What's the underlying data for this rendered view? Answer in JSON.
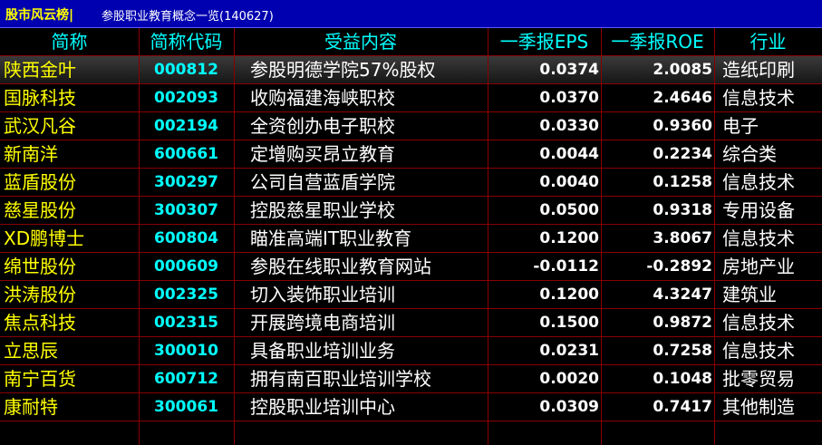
{
  "title": {
    "brand": "股市风云榜|",
    "text": "参股职业教育概念一览(140627)"
  },
  "columns": [
    "简称",
    "简称代码",
    "受益内容",
    "一季报EPS",
    "一季报ROE",
    "行业"
  ],
  "rows": [
    {
      "name": "陕西金叶",
      "code": "000812",
      "desc": "参股明德学院57%股权",
      "eps": "0.0374",
      "roe": "2.0085",
      "industry": "造纸印刷",
      "selected": true
    },
    {
      "name": "国脉科技",
      "code": "002093",
      "desc": "收购福建海峡职校",
      "eps": "0.0370",
      "roe": "2.4646",
      "industry": "信息技术"
    },
    {
      "name": "武汉凡谷",
      "code": "002194",
      "desc": "全资创办电子职校",
      "eps": "0.0330",
      "roe": "0.9360",
      "industry": "电子"
    },
    {
      "name": "新南洋",
      "code": "600661",
      "desc": "定增购买昂立教育",
      "eps": "0.0044",
      "roe": "0.2234",
      "industry": "综合类"
    },
    {
      "name": "蓝盾股份",
      "code": "300297",
      "desc": "公司自营蓝盾学院",
      "eps": "0.0040",
      "roe": "0.1258",
      "industry": "信息技术"
    },
    {
      "name": "慈星股份",
      "code": "300307",
      "desc": "控股慈星职业学校",
      "eps": "0.0500",
      "roe": "0.9318",
      "industry": "专用设备"
    },
    {
      "name": "XD鹏博士",
      "code": "600804",
      "desc": "瞄准高端IT职业教育",
      "eps": "0.1200",
      "roe": "3.8067",
      "industry": "信息技术"
    },
    {
      "name": "绵世股份",
      "code": "000609",
      "desc": "参股在线职业教育网站",
      "eps": "-0.0112",
      "roe": "-0.2892",
      "industry": "房地产业"
    },
    {
      "name": "洪涛股份",
      "code": "002325",
      "desc": "切入装饰职业培训",
      "eps": "0.1200",
      "roe": "4.3247",
      "industry": "建筑业"
    },
    {
      "name": "焦点科技",
      "code": "002315",
      "desc": "开展跨境电商培训",
      "eps": "0.1500",
      "roe": "0.9872",
      "industry": "信息技术"
    },
    {
      "name": "立思辰",
      "code": "300010",
      "desc": "具备职业培训业务",
      "eps": "0.0231",
      "roe": "0.7258",
      "industry": "信息技术"
    },
    {
      "name": "南宁百货",
      "code": "600712",
      "desc": "拥有南百职业培训学校",
      "eps": "0.0020",
      "roe": "0.1048",
      "industry": "批零贸易"
    },
    {
      "name": "康耐特",
      "code": "300061",
      "desc": "控股职业培训中心",
      "eps": "0.0309",
      "roe": "0.7417",
      "industry": "其他制造"
    }
  ],
  "colors": {
    "title_bg": "#0000b0",
    "brand": "#ffff00",
    "header_text": "#00ffff",
    "stock_name": "#ffff00",
    "stock_code": "#00ffff",
    "grid_line": "#8a0000",
    "background": "#000000"
  }
}
